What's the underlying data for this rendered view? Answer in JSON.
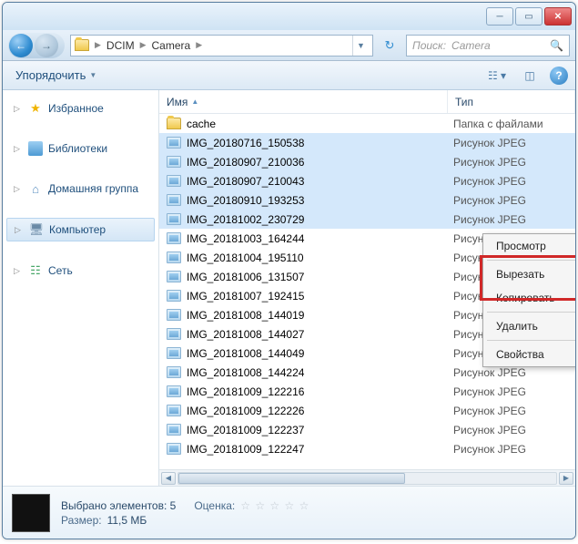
{
  "titlebar": {
    "min": "─",
    "max": "▭",
    "close": "✕"
  },
  "nav": {
    "back": "←",
    "fwd": "→",
    "breadcrumb": [
      {
        "label": "DCIM"
      },
      {
        "label": "Camera"
      }
    ],
    "search_prefix": "Поиск:",
    "search_placeholder": "Camera"
  },
  "toolbar": {
    "organize": "Упорядочить"
  },
  "sidebar": {
    "items": [
      {
        "label": "Избранное",
        "icon": "star"
      },
      {
        "label": "Библиотеки",
        "icon": "lib"
      },
      {
        "label": "Домашняя группа",
        "icon": "home"
      },
      {
        "label": "Компьютер",
        "icon": "comp",
        "selected": true
      },
      {
        "label": "Сеть",
        "icon": "net"
      }
    ]
  },
  "columns": {
    "name": "Имя",
    "type": "Тип"
  },
  "files": [
    {
      "name": "cache",
      "ftype": "folder",
      "type": "Папка с файлами",
      "sel": false
    },
    {
      "name": "IMG_20180716_150538",
      "ftype": "img",
      "type": "Рисунок JPEG",
      "sel": true
    },
    {
      "name": "IMG_20180907_210036",
      "ftype": "img",
      "type": "Рисунок JPEG",
      "sel": true
    },
    {
      "name": "IMG_20180907_210043",
      "ftype": "img",
      "type": "Рисунок JPEG",
      "sel": true
    },
    {
      "name": "IMG_20180910_193253",
      "ftype": "img",
      "type": "Рисунок JPEG",
      "sel": true
    },
    {
      "name": "IMG_20181002_230729",
      "ftype": "img",
      "type": "Рисунок JPEG",
      "sel": true
    },
    {
      "name": "IMG_20181003_164244",
      "ftype": "img",
      "type": "Рисунок JPEG",
      "sel": false
    },
    {
      "name": "IMG_20181004_195110",
      "ftype": "img",
      "type": "Рисунок JPEG",
      "sel": false
    },
    {
      "name": "IMG_20181006_131507",
      "ftype": "img",
      "type": "Рисунок JPEG",
      "sel": false
    },
    {
      "name": "IMG_20181007_192415",
      "ftype": "img",
      "type": "Рисунок JPEG",
      "sel": false
    },
    {
      "name": "IMG_20181008_144019",
      "ftype": "img",
      "type": "Рисунок JPEG",
      "sel": false
    },
    {
      "name": "IMG_20181008_144027",
      "ftype": "img",
      "type": "Рисунок JPEG",
      "sel": false
    },
    {
      "name": "IMG_20181008_144049",
      "ftype": "img",
      "type": "Рисунок JPEG",
      "sel": false
    },
    {
      "name": "IMG_20181008_144224",
      "ftype": "img",
      "type": "Рисунок JPEG",
      "sel": false
    },
    {
      "name": "IMG_20181009_122216",
      "ftype": "img",
      "type": "Рисунок JPEG",
      "sel": false
    },
    {
      "name": "IMG_20181009_122226",
      "ftype": "img",
      "type": "Рисунок JPEG",
      "sel": false
    },
    {
      "name": "IMG_20181009_122237",
      "ftype": "img",
      "type": "Рисунок JPEG",
      "sel": false
    },
    {
      "name": "IMG_20181009_122247",
      "ftype": "img",
      "type": "Рисунок JPEG",
      "sel": false
    }
  ],
  "context_menu": {
    "groups": [
      [
        "Просмотр"
      ],
      [
        "Вырезать",
        "Копировать"
      ],
      [
        "Удалить"
      ],
      [
        "Свойства"
      ]
    ]
  },
  "details": {
    "line1_label": "Выбрано элементов: 5",
    "rating_label": "Оценка:",
    "size_label": "Размер:",
    "size_value": "11,5 МБ"
  }
}
